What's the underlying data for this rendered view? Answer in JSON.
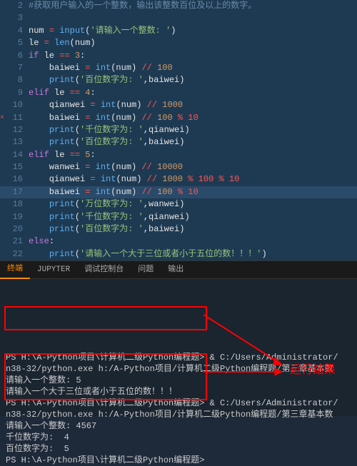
{
  "editor": {
    "lines": [
      {
        "n": 2,
        "segs": [
          {
            "cls": "c-comment",
            "t": "#获取用户输入的一个整数，输出该整数百位及以上的数字。"
          }
        ]
      },
      {
        "n": 3,
        "segs": []
      },
      {
        "n": 4,
        "segs": [
          {
            "cls": "c-id",
            "t": "num "
          },
          {
            "cls": "c-op",
            "t": "="
          },
          {
            "cls": "c-id",
            "t": " "
          },
          {
            "cls": "c-fn",
            "t": "input"
          },
          {
            "cls": "c-id",
            "t": "("
          },
          {
            "cls": "c-str",
            "t": "'请输入一个整数: '"
          },
          {
            "cls": "c-id",
            "t": ")"
          }
        ]
      },
      {
        "n": 5,
        "segs": [
          {
            "cls": "c-id",
            "t": "le "
          },
          {
            "cls": "c-op",
            "t": "="
          },
          {
            "cls": "c-id",
            "t": " "
          },
          {
            "cls": "c-fn",
            "t": "len"
          },
          {
            "cls": "c-id",
            "t": "(num)"
          }
        ]
      },
      {
        "n": 6,
        "segs": [
          {
            "cls": "c-kw",
            "t": "if"
          },
          {
            "cls": "c-id",
            "t": " le "
          },
          {
            "cls": "c-op",
            "t": "=="
          },
          {
            "cls": "c-id",
            "t": " "
          },
          {
            "cls": "c-num",
            "t": "3"
          },
          {
            "cls": "c-id",
            "t": ":"
          }
        ]
      },
      {
        "n": 7,
        "segs": [
          {
            "cls": "c-id",
            "t": "    baiwei "
          },
          {
            "cls": "c-op",
            "t": "="
          },
          {
            "cls": "c-id",
            "t": " "
          },
          {
            "cls": "c-fn",
            "t": "int"
          },
          {
            "cls": "c-id",
            "t": "(num) "
          },
          {
            "cls": "c-op",
            "t": "//"
          },
          {
            "cls": "c-id",
            "t": " "
          },
          {
            "cls": "c-num",
            "t": "100"
          }
        ]
      },
      {
        "n": 8,
        "segs": [
          {
            "cls": "c-id",
            "t": "    "
          },
          {
            "cls": "c-fn",
            "t": "print"
          },
          {
            "cls": "c-id",
            "t": "("
          },
          {
            "cls": "c-str",
            "t": "'百位数字为: '"
          },
          {
            "cls": "c-id",
            "t": ",baiwei)"
          }
        ]
      },
      {
        "n": 9,
        "segs": [
          {
            "cls": "c-kw",
            "t": "elif"
          },
          {
            "cls": "c-id",
            "t": " le "
          },
          {
            "cls": "c-op",
            "t": "=="
          },
          {
            "cls": "c-id",
            "t": " "
          },
          {
            "cls": "c-num",
            "t": "4"
          },
          {
            "cls": "c-id",
            "t": ":"
          }
        ]
      },
      {
        "n": 10,
        "segs": [
          {
            "cls": "c-id",
            "t": "    qianwei "
          },
          {
            "cls": "c-op",
            "t": "="
          },
          {
            "cls": "c-id",
            "t": " "
          },
          {
            "cls": "c-fn",
            "t": "int"
          },
          {
            "cls": "c-id",
            "t": "(num) "
          },
          {
            "cls": "c-op",
            "t": "//"
          },
          {
            "cls": "c-id",
            "t": " "
          },
          {
            "cls": "c-num",
            "t": "1000"
          }
        ]
      },
      {
        "n": 11,
        "err": true,
        "segs": [
          {
            "cls": "c-id",
            "t": "    baiwei "
          },
          {
            "cls": "c-op",
            "t": "="
          },
          {
            "cls": "c-id",
            "t": " "
          },
          {
            "cls": "c-fn",
            "t": "int"
          },
          {
            "cls": "c-id",
            "t": "(num) "
          },
          {
            "cls": "c-op",
            "t": "//"
          },
          {
            "cls": "c-id",
            "t": " "
          },
          {
            "cls": "c-num",
            "t": "100"
          },
          {
            "cls": "c-id",
            "t": " "
          },
          {
            "cls": "c-op",
            "t": "% 10"
          }
        ]
      },
      {
        "n": 12,
        "segs": [
          {
            "cls": "c-id",
            "t": "    "
          },
          {
            "cls": "c-fn",
            "t": "print"
          },
          {
            "cls": "c-id",
            "t": "("
          },
          {
            "cls": "c-str",
            "t": "'千位数字为: '"
          },
          {
            "cls": "c-id",
            "t": ",qianwei)"
          }
        ]
      },
      {
        "n": 13,
        "segs": [
          {
            "cls": "c-id",
            "t": "    "
          },
          {
            "cls": "c-fn",
            "t": "print"
          },
          {
            "cls": "c-id",
            "t": "("
          },
          {
            "cls": "c-str",
            "t": "'百位数字为: '"
          },
          {
            "cls": "c-id",
            "t": ",baiwei)"
          }
        ]
      },
      {
        "n": 14,
        "segs": [
          {
            "cls": "c-kw",
            "t": "elif"
          },
          {
            "cls": "c-id",
            "t": " le "
          },
          {
            "cls": "c-op",
            "t": "=="
          },
          {
            "cls": "c-id",
            "t": " "
          },
          {
            "cls": "c-num",
            "t": "5"
          },
          {
            "cls": "c-id",
            "t": ":"
          }
        ]
      },
      {
        "n": 15,
        "segs": [
          {
            "cls": "c-id",
            "t": "    wanwei "
          },
          {
            "cls": "c-op",
            "t": "="
          },
          {
            "cls": "c-id",
            "t": " "
          },
          {
            "cls": "c-fn",
            "t": "int"
          },
          {
            "cls": "c-id",
            "t": "(num) "
          },
          {
            "cls": "c-op",
            "t": "//"
          },
          {
            "cls": "c-id",
            "t": " "
          },
          {
            "cls": "c-num",
            "t": "10000"
          }
        ]
      },
      {
        "n": 16,
        "segs": [
          {
            "cls": "c-id",
            "t": "    qianwei "
          },
          {
            "cls": "c-op",
            "t": "="
          },
          {
            "cls": "c-id",
            "t": " "
          },
          {
            "cls": "c-fn",
            "t": "int"
          },
          {
            "cls": "c-id",
            "t": "(num) "
          },
          {
            "cls": "c-op",
            "t": "//"
          },
          {
            "cls": "c-id",
            "t": " "
          },
          {
            "cls": "c-num",
            "t": "1000"
          },
          {
            "cls": "c-id",
            "t": " "
          },
          {
            "cls": "c-op",
            "t": "% 100 % 10"
          }
        ]
      },
      {
        "n": 17,
        "hl": true,
        "segs": [
          {
            "cls": "c-id",
            "t": "    baiwei "
          },
          {
            "cls": "c-op",
            "t": "="
          },
          {
            "cls": "c-id",
            "t": " "
          },
          {
            "cls": "c-fn",
            "t": "int"
          },
          {
            "cls": "c-id",
            "t": "(num) "
          },
          {
            "cls": "c-op",
            "t": "//"
          },
          {
            "cls": "c-id",
            "t": " "
          },
          {
            "cls": "c-num",
            "t": "100"
          },
          {
            "cls": "c-id",
            "t": " "
          },
          {
            "cls": "c-op",
            "t": "% 10"
          }
        ]
      },
      {
        "n": 18,
        "segs": [
          {
            "cls": "c-id",
            "t": "    "
          },
          {
            "cls": "c-fn",
            "t": "print"
          },
          {
            "cls": "c-id",
            "t": "("
          },
          {
            "cls": "c-str",
            "t": "'万位数字为: '"
          },
          {
            "cls": "c-id",
            "t": ",wanwei)"
          }
        ]
      },
      {
        "n": 19,
        "segs": [
          {
            "cls": "c-id",
            "t": "    "
          },
          {
            "cls": "c-fn",
            "t": "print"
          },
          {
            "cls": "c-id",
            "t": "("
          },
          {
            "cls": "c-str",
            "t": "'千位数字为: '"
          },
          {
            "cls": "c-id",
            "t": ",qianwei)"
          }
        ]
      },
      {
        "n": 20,
        "segs": [
          {
            "cls": "c-id",
            "t": "    "
          },
          {
            "cls": "c-fn",
            "t": "print"
          },
          {
            "cls": "c-id",
            "t": "("
          },
          {
            "cls": "c-str",
            "t": "'百位数字为: '"
          },
          {
            "cls": "c-id",
            "t": ",baiwei)"
          }
        ]
      },
      {
        "n": 21,
        "segs": [
          {
            "cls": "c-kw",
            "t": "else"
          },
          {
            "cls": "c-id",
            "t": ":"
          }
        ]
      },
      {
        "n": 22,
        "segs": [
          {
            "cls": "c-id",
            "t": "    "
          },
          {
            "cls": "c-fn",
            "t": "print"
          },
          {
            "cls": "c-id",
            "t": "("
          },
          {
            "cls": "c-str",
            "t": "'请输入一个大于三位或者小于五位的数！！！'"
          },
          {
            "cls": "c-id",
            "t": ")"
          }
        ]
      }
    ]
  },
  "tabs": [
    "终端",
    "JUPYTER",
    "调试控制台",
    "问题",
    "输出"
  ],
  "terminal": [
    "",
    "PS H:\\A-Python项目\\计算机二级Python编程题> & C:/Users/Administrator/",
    "n38-32/python.exe h:/A-Python项目/计算机二级Python编程题/第三章基本数",
    "请输入一个整数: 5",
    "请输入一个大于三位或者小于五位的数！！！",
    "PS H:\\A-Python项目\\计算机二级Python编程题> & C:/Users/Administrator/",
    "n38-32/python.exe h:/A-Python项目/计算机二级Python编程题/第三章基本数",
    "请输入一个整数: 4567",
    "千位数字为:  4",
    "百位数字为:  5",
    "PS H:\\A-Python项目\\计算机二级Python编程题>"
  ],
  "annotation": "运行结果"
}
